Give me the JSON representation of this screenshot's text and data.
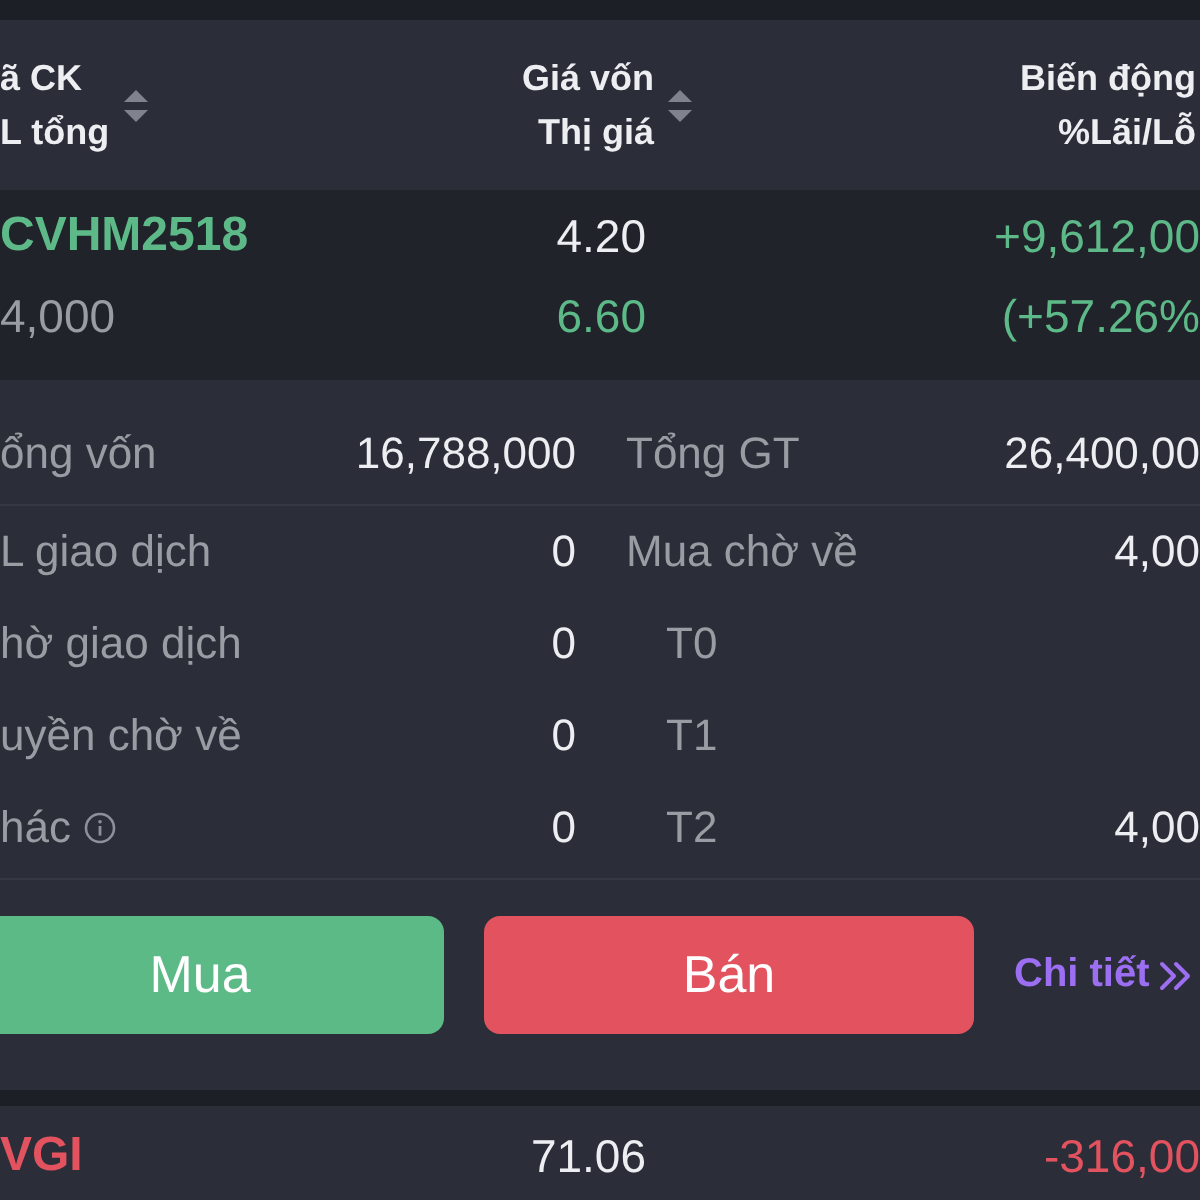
{
  "header": {
    "columns": [
      {
        "line_1": "ã CK",
        "line_2": "L tổng",
        "sortable": true
      },
      {
        "line_1": "Giá vốn",
        "line_2": "Thị giá",
        "sortable": true
      },
      {
        "line_1": "Biến động",
        "line_2": "%Lãi/Lỗ"
      }
    ]
  },
  "holdings": [
    {
      "symbol": "CVHM2518",
      "color": "#5dba88",
      "expanded": true,
      "volume": "4,000",
      "cost_price": "4.20",
      "market_price": "6.60",
      "profit": "+9,612,00",
      "profit_percent": "(+57.26%",
      "details": {
        "summary": {
          "left": {
            "label": "ổng vốn",
            "value": "16,788,000"
          },
          "right": {
            "label": "Tổng GT",
            "value": "26,400,00"
          }
        },
        "rows": [
          {
            "left": {
              "label": "L giao dịch",
              "value": "0"
            },
            "right": {
              "label": "Mua chờ về",
              "value": "4,00",
              "indent": false
            }
          },
          {
            "left": {
              "label": "hờ giao dịch",
              "value": "0"
            },
            "right": {
              "label": "T0",
              "indent": true
            }
          },
          {
            "left": {
              "label": "uyền chờ về",
              "value": "0"
            },
            "right": {
              "label": "T1",
              "indent": true
            }
          },
          {
            "left": {
              "label": "hác",
              "value": "0",
              "info": true
            },
            "right": {
              "label": "T2",
              "value": "4,00",
              "indent": true
            }
          }
        ],
        "actions": [
          {
            "kind": "buy",
            "label": "Mua"
          },
          {
            "kind": "sell",
            "label": "Bán"
          },
          {
            "kind": "link",
            "label": "Chi tiết"
          }
        ]
      }
    },
    {
      "symbol": "VGI",
      "color": "#e2535f",
      "expanded": false,
      "cost_price": "71.06",
      "profit": "-316,00"
    }
  ]
}
